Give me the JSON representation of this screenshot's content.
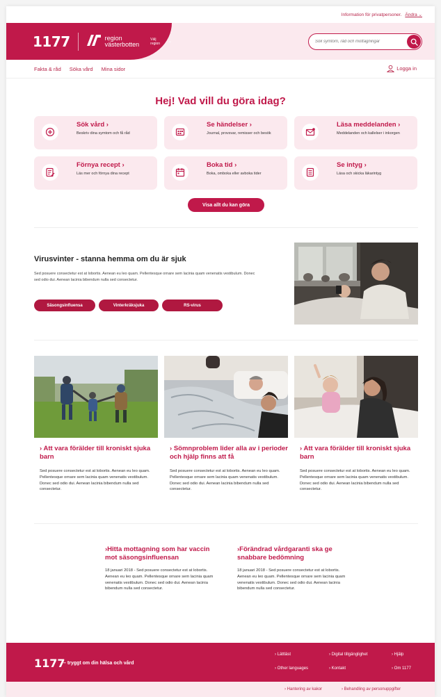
{
  "topbar": {
    "info": "Information för privatpersoner.",
    "change": "Ändra"
  },
  "header": {
    "logo": "1177",
    "region_logo": "region västerbotten",
    "region_line1": "region",
    "region_line2": "västerbotten",
    "region_select": "Välj region",
    "search_placeholder": "Sök symtom, råd och mottagningar"
  },
  "nav": {
    "items": [
      "Fakta & råd",
      "Söka vård",
      "Mina sidor"
    ],
    "login": "Logga in"
  },
  "hero": {
    "title": "Hej! Vad vill du göra idag?"
  },
  "cards": [
    {
      "title": "Sök vård",
      "desc": "Beskriv dina symtom och få råd",
      "icon": "medical-cross-icon"
    },
    {
      "title": "Se händelser",
      "desc": "Journal, provsvar, remisser och besök",
      "icon": "calendar-grid-icon"
    },
    {
      "title": "Läsa meddelanden",
      "desc": "Meddelanden och kallelser i inkorgen",
      "icon": "envelope-icon"
    },
    {
      "title": "Förnya recept",
      "desc": "Läs mer och förnya dina recept",
      "icon": "prescription-icon"
    },
    {
      "title": "Boka tid",
      "desc": "Boka, omboka eller avboka tider",
      "icon": "calendar-icon"
    },
    {
      "title": "Se intyg",
      "desc": "Läsa och skicka läkarintyg",
      "icon": "document-icon"
    }
  ],
  "show_all": "Visa allt du kan göra",
  "virus": {
    "title": "Virusvinter - stanna hemma om du är sjuk",
    "text": "Sed posuere consectetur est at lobortis. Aenean eu leo quam. Pellentesque ornare sem lacinia quam venenatis vestibulum. Donec sed odio dui. Aenean lacinia bibendum nulla sed consectetur.",
    "pills": [
      "Säsongsinfluensa",
      "Vinterkräksjuka",
      "RS-virus"
    ]
  },
  "articles": [
    {
      "title": "Att vara förälder till kroniskt sjuka barn",
      "text": "Sed posuere consectetur est at lobortis. Aenean eu leo quam. Pellentesque ornare sem lacinia quam venenatis vestibulum. Donec sed odio dui. Aenean lacinia bibendum nulla sed consectetur."
    },
    {
      "title": "Sömnproblem lider alla av i perioder och hjälp finns att få",
      "text": "Sed posuere consectetur est at lobortis. Aenean eu leo quam. Pellentesque ornare sem lacinia quam venenatis vestibulum. Donec sed odio dui. Aenean lacinia bibendum nulla sed consectetur."
    },
    {
      "title": "Att vara förälder till kroniskt sjuka barn",
      "text": "Sed posuere consectetur est at lobortis. Aenean eu leo quam. Pellentesque ornare sem lacinia quam venenatis vestibulum. Donec sed odio dui. Aenean lacinia bibendum nulla sed consectetur."
    }
  ],
  "news": [
    {
      "title": "Hitta mottagning som har vaccin mot säsongsinfluensan",
      "text": "18 januari 2018 - Sed posuere consectetur est at lobortis. Aenean eu leo quam. Pellentesque ornare sem lacinia quam venenatis vestibulum. Donec sed odio dui. Aenean lacinia bibendum nulla sed consectetur."
    },
    {
      "title": "Förändrad vårdgaranti ska ge snabbare bedömning",
      "text": "18 januari 2018 - Sed posuere consectetur est at lobortis. Aenean eu leo quam. Pellentesque ornare sem lacinia quam venenatis vestibulum. Donec sed odio dui. Aenean lacinia bibendum nulla sed consectetur."
    }
  ],
  "footer": {
    "logo": "1177",
    "tagline": "– tryggt om din hälsa och vård",
    "links": [
      "Lättläst",
      "Digital tillgänglighet",
      "Hjälp",
      "Other languages",
      "Kontakt",
      "Om 1177"
    ]
  },
  "subfooter": {
    "links": [
      "Hantering av kakor",
      "Behandling av personuppgifter"
    ]
  },
  "colors": {
    "brand": "#c0194a",
    "brand_light": "#fbe9ee"
  }
}
